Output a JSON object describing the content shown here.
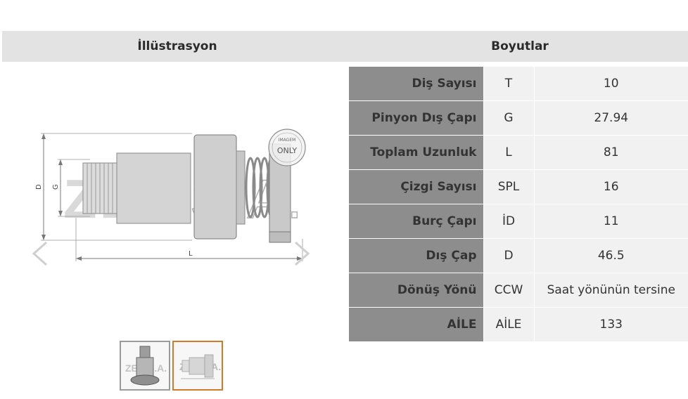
{
  "headers": {
    "illustration": "İllüstrasyon",
    "dimensions": "Boyutlar"
  },
  "illustration": {
    "dim_labels": {
      "d": "D",
      "g": "G",
      "l": "L"
    },
    "watermark": "ZEN S.A.",
    "stamp_text": "IMAGEM ONLY",
    "nav_prev_icon": "chevron-left-icon",
    "nav_next_icon": "chevron-right-icon",
    "selected_thumbnail": 2
  },
  "dimensions": [
    {
      "label": "Diş Sayısı",
      "symbol": "T",
      "value": "10"
    },
    {
      "label": "Pinyon Dış Çapı",
      "symbol": "G",
      "value": "27.94"
    },
    {
      "label": "Toplam Uzunluk",
      "symbol": "L",
      "value": "81"
    },
    {
      "label": "Çizgi Sayısı",
      "symbol": "SPL",
      "value": "16"
    },
    {
      "label": "Burç Çapı",
      "symbol": "İD",
      "value": "11"
    },
    {
      "label": "Dış Çap",
      "symbol": "D",
      "value": "46.5"
    },
    {
      "label": "Dönüş Yönü",
      "symbol": "CCW",
      "value": "Saat yönünün tersine"
    },
    {
      "label": "AİLE",
      "symbol": "AİLE",
      "value": "133"
    }
  ],
  "colors": {
    "header_bg": "#e3e3e3",
    "label_bg": "#8d8d8d",
    "cell_bg": "#f1f1f1",
    "thumb_active_border": "#d07a2a"
  }
}
